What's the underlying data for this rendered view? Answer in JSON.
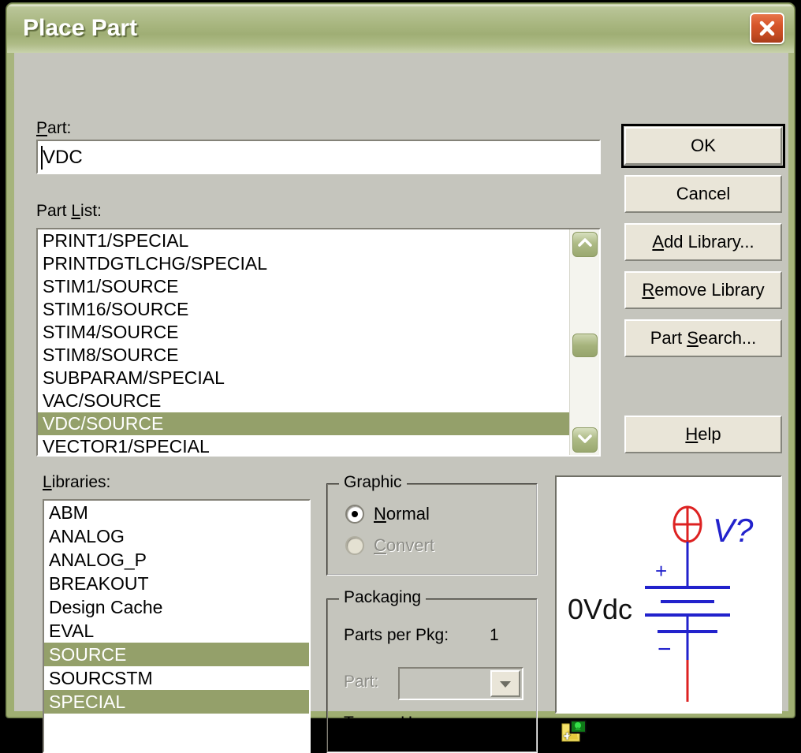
{
  "window": {
    "title": "Place Part",
    "close_label": "Close",
    "theme_accent": "#9fae72",
    "selection_color": "#94a06a",
    "close_button_color": "#d6542a"
  },
  "part": {
    "label": "Part:",
    "label_accel": "P",
    "value": "VDC"
  },
  "part_list": {
    "label": "Part List:",
    "label_accel": "L",
    "items": [
      {
        "text": "PRINT1/SPECIAL",
        "selected": false
      },
      {
        "text": "PRINTDGTLCHG/SPECIAL",
        "selected": false
      },
      {
        "text": "STIM1/SOURCE",
        "selected": false
      },
      {
        "text": "STIM16/SOURCE",
        "selected": false
      },
      {
        "text": "STIM4/SOURCE",
        "selected": false
      },
      {
        "text": "STIM8/SOURCE",
        "selected": false
      },
      {
        "text": "SUBPARAM/SPECIAL",
        "selected": false
      },
      {
        "text": "VAC/SOURCE",
        "selected": false
      },
      {
        "text": "VDC/SOURCE",
        "selected": true
      },
      {
        "text": "VECTOR1/SPECIAL",
        "selected": false
      }
    ],
    "scrollbar": {
      "up_icon": "chevron-up-icon",
      "down_icon": "chevron-down-icon"
    }
  },
  "libraries": {
    "label": "Libraries:",
    "label_accel": "L",
    "items": [
      {
        "text": "ABM",
        "selected": false
      },
      {
        "text": "ANALOG",
        "selected": false
      },
      {
        "text": "ANALOG_P",
        "selected": false
      },
      {
        "text": "BREAKOUT",
        "selected": false
      },
      {
        "text": "Design Cache",
        "selected": false
      },
      {
        "text": "EVAL",
        "selected": false
      },
      {
        "text": "SOURCE",
        "selected": true
      },
      {
        "text": "SOURCSTM",
        "selected": false
      },
      {
        "text": "SPECIAL",
        "selected": true
      }
    ]
  },
  "buttons": {
    "ok": "OK",
    "cancel": "Cancel",
    "add_library": "Add Library...",
    "add_library_accel": "A",
    "remove_library": "Remove Library",
    "remove_library_accel": "R",
    "part_search": "Part Search...",
    "part_search_accel": "S",
    "help": "Help",
    "help_accel": "H"
  },
  "graphic": {
    "title": "Graphic",
    "normal": {
      "label": "Normal",
      "accel": "N",
      "selected": true,
      "enabled": true
    },
    "convert": {
      "label": "Convert",
      "accel": "C",
      "selected": false,
      "enabled": false
    }
  },
  "packaging": {
    "title": "Packaging",
    "parts_per_pkg_label": "Parts per Pkg:",
    "parts_per_pkg_value": "1",
    "part_label": "Part:",
    "part_value": "",
    "part_enabled": false,
    "type_label": "Type:",
    "type_value": "Homogeneous"
  },
  "preview": {
    "symbol_name": "VDC",
    "value_label": "0Vdc",
    "reference_label": "V?",
    "plus_label": "+",
    "minus_label": "−",
    "wire_color": "#2222cc",
    "pin_color": "#dd2222",
    "graphic_icon_name": "new-graphic-icon"
  }
}
